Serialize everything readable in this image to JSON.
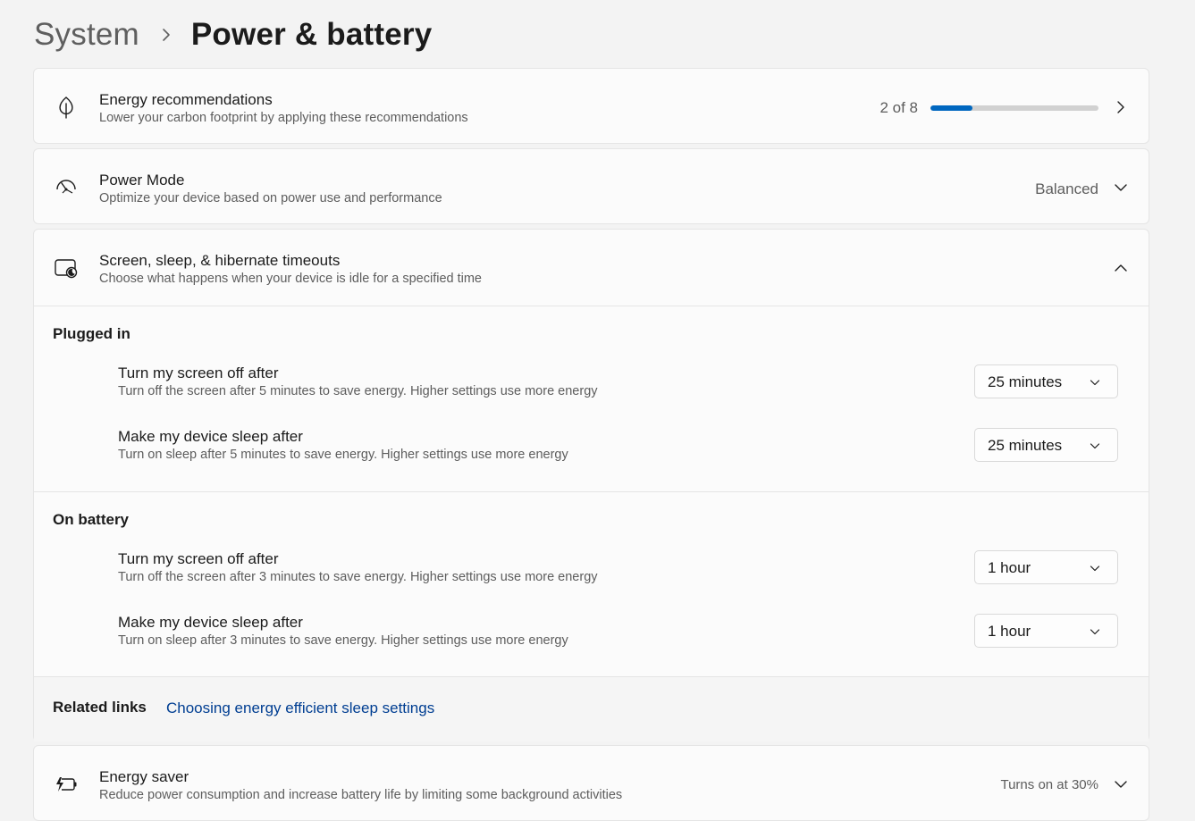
{
  "breadcrumb": {
    "parent": "System",
    "current": "Power & battery"
  },
  "energy_recommendations": {
    "title": "Energy recommendations",
    "description": "Lower your carbon footprint by applying these recommendations",
    "progress_text": "2 of 8",
    "progress_fraction": 0.25,
    "icon": "leaf-icon"
  },
  "power_mode": {
    "title": "Power Mode",
    "description": "Optimize your device based on power use and performance",
    "value": "Balanced",
    "icon": "gauge-icon"
  },
  "timeouts": {
    "title": "Screen, sleep, & hibernate timeouts",
    "description": "Choose what happens when your device is idle for a specified time",
    "icon": "screen-moon-icon",
    "plugged_in": {
      "label": "Plugged in",
      "screen_off": {
        "title": "Turn my screen off after",
        "description": "Turn off the screen after 5 minutes to save energy. Higher settings use more energy",
        "value": "25 minutes"
      },
      "sleep": {
        "title": "Make my device sleep after",
        "description": "Turn on sleep after 5 minutes to save energy. Higher settings use more energy",
        "value": "25 minutes"
      }
    },
    "on_battery": {
      "label": "On battery",
      "screen_off": {
        "title": "Turn my screen off after",
        "description": "Turn off the screen after 3 minutes to save energy. Higher settings use more energy",
        "value": "1 hour"
      },
      "sleep": {
        "title": "Make my device sleep after",
        "description": "Turn on sleep after 3 minutes to save energy. Higher settings use more energy",
        "value": "1 hour"
      }
    },
    "related": {
      "label": "Related links",
      "link": "Choosing energy efficient sleep settings"
    }
  },
  "energy_saver": {
    "title": "Energy saver",
    "description": "Reduce power consumption and increase battery life by limiting some background activities",
    "value": "Turns on at 30%",
    "icon": "battery-saver-icon"
  },
  "colors": {
    "accent": "#0067c0",
    "link": "#003e92"
  }
}
